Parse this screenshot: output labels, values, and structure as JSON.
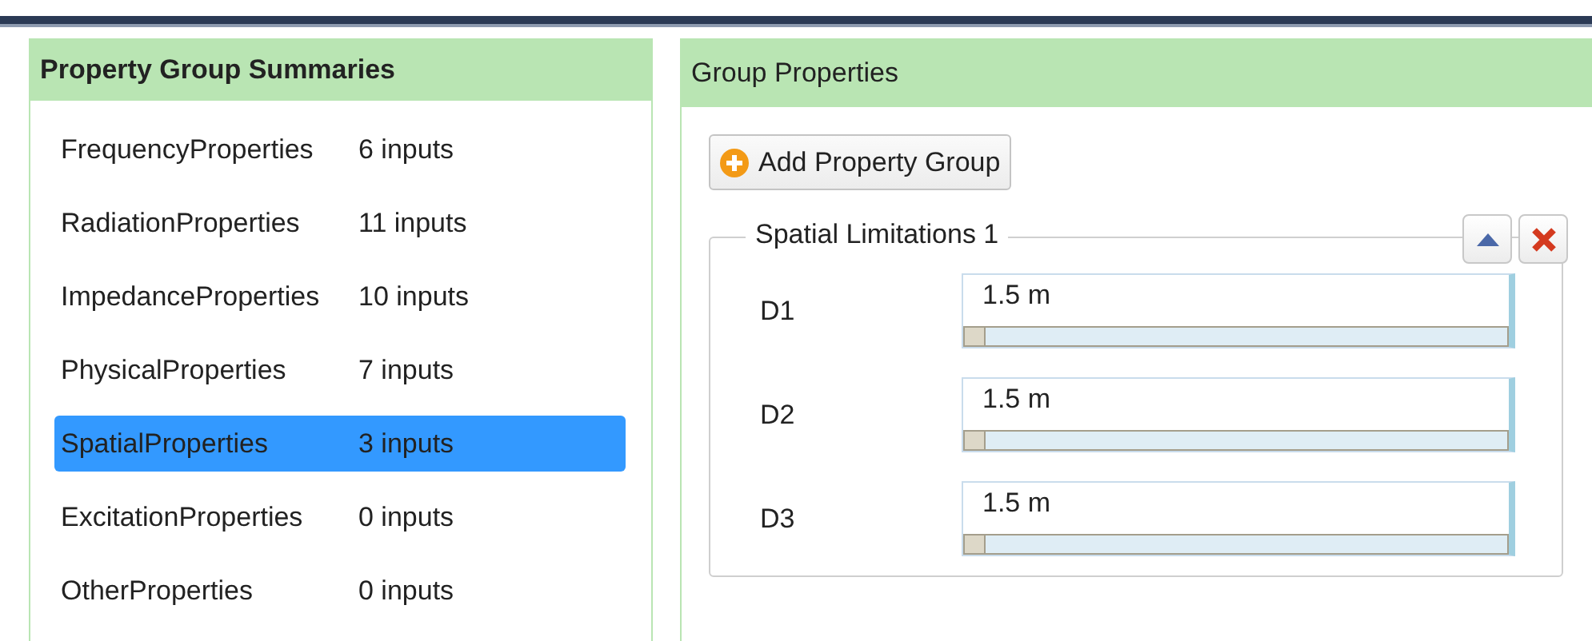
{
  "summaries": {
    "title": "Property Group Summaries",
    "items": [
      {
        "name": "FrequencyProperties",
        "count": "6 inputs",
        "selected": false
      },
      {
        "name": "RadiationProperties",
        "count": "11 inputs",
        "selected": false
      },
      {
        "name": "ImpedanceProperties",
        "count": "10 inputs",
        "selected": false
      },
      {
        "name": "PhysicalProperties",
        "count": "7 inputs",
        "selected": false
      },
      {
        "name": "SpatialProperties",
        "count": "3 inputs",
        "selected": true
      },
      {
        "name": "ExcitationProperties",
        "count": "0 inputs",
        "selected": false
      },
      {
        "name": "OtherProperties",
        "count": "0 inputs",
        "selected": false
      }
    ]
  },
  "group_properties": {
    "title": "Group Properties",
    "add_button": "Add Property Group",
    "group": {
      "title": "Spatial Limitations 1",
      "fields": [
        {
          "label": "D1",
          "value": "1.5 m"
        },
        {
          "label": "D2",
          "value": "1.5 m"
        },
        {
          "label": "D3",
          "value": "1.5 m"
        }
      ]
    }
  }
}
